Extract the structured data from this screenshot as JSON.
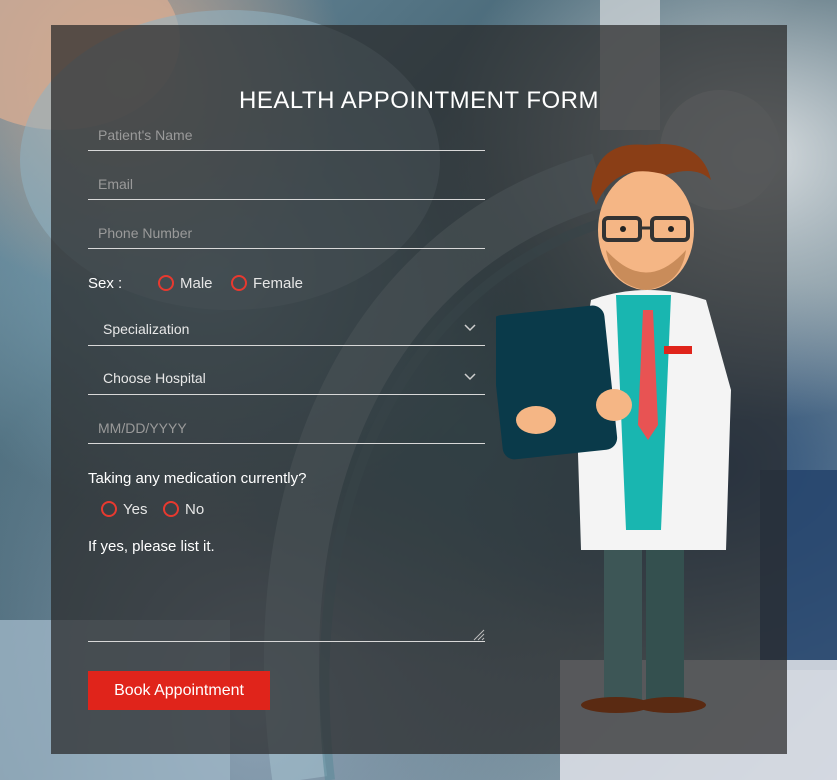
{
  "form": {
    "title": "HEALTH APPOINTMENT FORM",
    "patient_name_placeholder": "Patient's Name",
    "email_placeholder": "Email",
    "phone_placeholder": "Phone Number",
    "sex_label": "Sex :",
    "sex_options": [
      "Male",
      "Female"
    ],
    "specialization_label": "Specialization",
    "hospital_label": "Choose Hospital",
    "date_placeholder": "MM/DD/YYYY",
    "medication_question": "Taking any medication currently?",
    "medication_options": [
      "Yes",
      "No"
    ],
    "list_label": "If yes, please list it.",
    "submit_label": "Book Appointment"
  },
  "colors": {
    "accent": "#e0241b",
    "panel": "rgba(40,40,40,0.72)"
  },
  "icons": {
    "select_arrow": "chevron-down-icon",
    "resize": "resize-handle-icon",
    "illustration": "doctor-illustration"
  }
}
